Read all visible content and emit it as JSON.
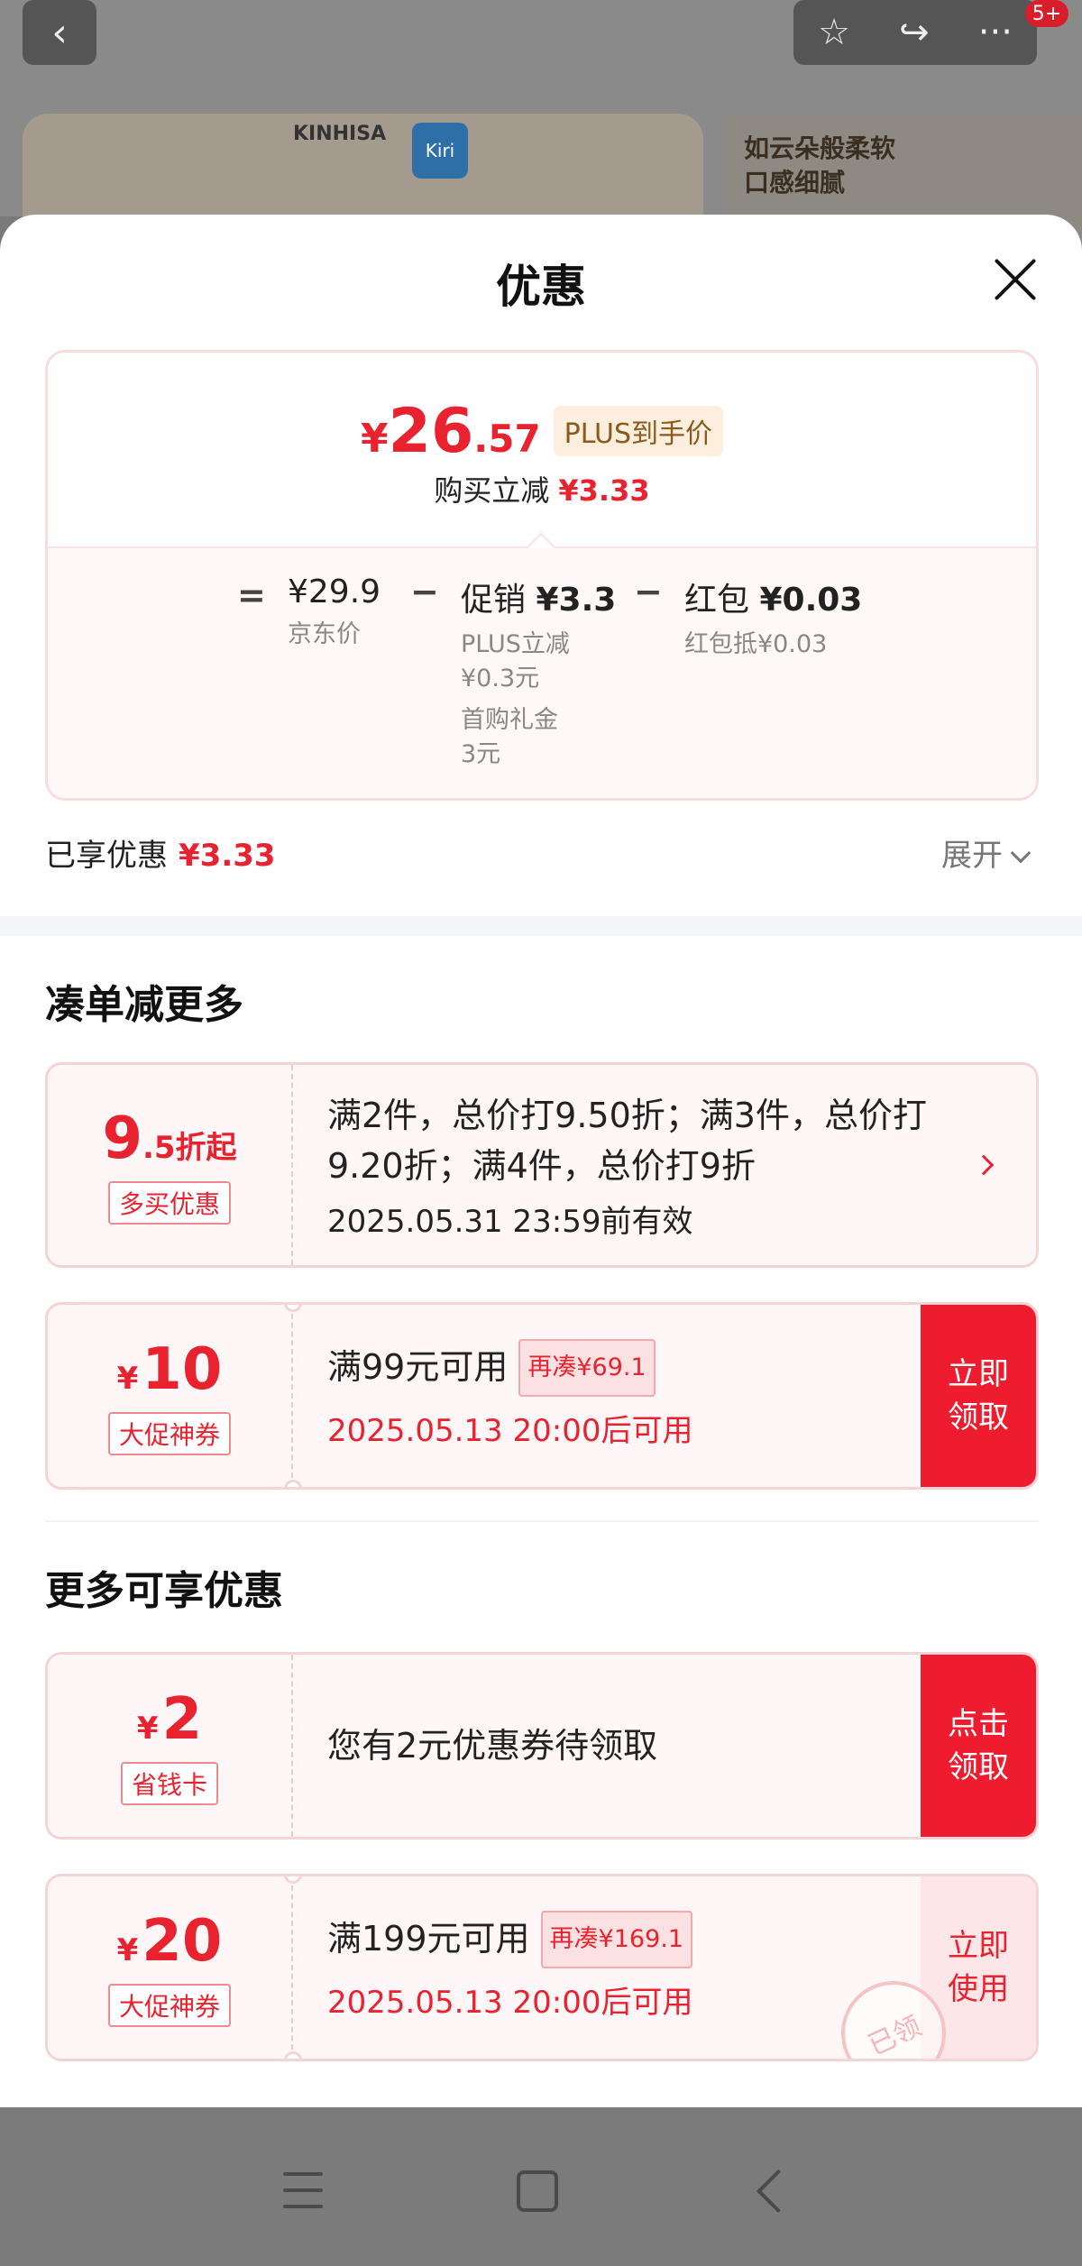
{
  "background_page": {
    "badge": "5+",
    "brand_logo": "KINHISA",
    "brand_badge": "Kiri",
    "banner_text": "如云朵般柔软\n口感细腻"
  },
  "sheet": {
    "title": "优惠",
    "price_box": {
      "price_yen": "¥",
      "price_int": "26",
      "price_dec": ".57",
      "plus_tag": "PLUS到手价",
      "reduce_label": "购买立减",
      "reduce_value": "¥3.33",
      "calc": {
        "equals": "=",
        "minus": "−",
        "jd_price_value": "¥29.9",
        "jd_price_label": "京东价",
        "promo_title": "促销",
        "promo_value": "¥3.3",
        "promo_sub1": "PLUS立减\n¥0.3元",
        "promo_sub2": "首购礼金\n3元",
        "redpacket_title": "红包",
        "redpacket_value": "¥0.03",
        "redpacket_sub": "红包抵¥0.03"
      }
    },
    "enjoyed_label": "已享优惠",
    "enjoyed_value": "¥3.33",
    "expand_label": "展开",
    "section_combine": "凑单减更多",
    "coupons_combine": [
      {
        "amount_num": "9",
        "amount_small": ".5折起",
        "tag": "多买优惠",
        "main": "满2件，总价打9.50折；满3件，总价打9.20折；满4件，总价打9折",
        "sub": "2025.05.31 23:59前有效"
      },
      {
        "yen": "¥",
        "amount_num": "10",
        "tag": "大促神券",
        "main": "满99元可用",
        "mini": "再凑¥69.1",
        "sub": "2025.05.13 20:00后可用",
        "action": "立即\n领取"
      }
    ],
    "section_more": "更多可享优惠",
    "coupons_more": [
      {
        "yen": "¥",
        "amount_num": "2",
        "tag": "省钱卡",
        "main": "您有2元优惠券待领取",
        "action": "点击\n领取"
      },
      {
        "yen": "¥",
        "amount_num": "20",
        "tag": "大促神券",
        "main": "满199元可用",
        "mini": "再凑¥169.1",
        "sub": "2025.05.13 20:00后可用",
        "action": "立即\n使用",
        "stamp": "已领"
      }
    ]
  },
  "colors": {
    "accent": "#e8232f",
    "action_bg": "#ee1c2e"
  }
}
